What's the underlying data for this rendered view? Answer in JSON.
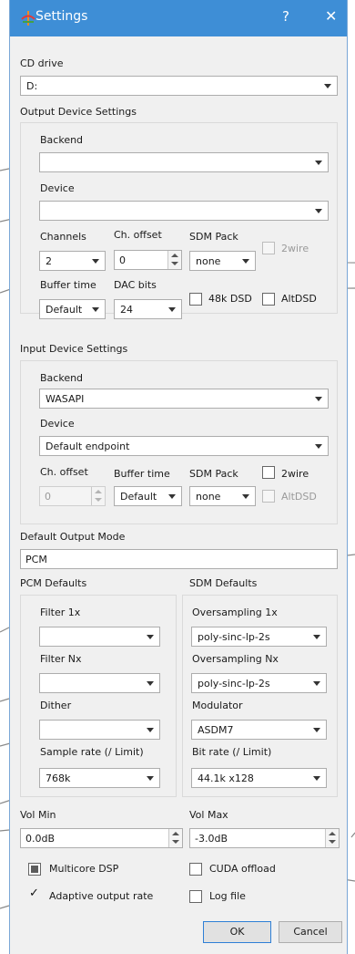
{
  "window": {
    "title": "Settings",
    "help_glyph": "?",
    "close_glyph": "✕"
  },
  "cd": {
    "label": "CD drive",
    "value": "D:"
  },
  "output": {
    "group_title": "Output Device Settings",
    "backend_label": "Backend",
    "backend_value": "",
    "device_label": "Device",
    "device_value": "",
    "channels_label": "Channels",
    "channels_value": "2",
    "choffset_label": "Ch. offset",
    "choffset_value": "0",
    "sdmpack_label": "SDM Pack",
    "sdmpack_value": "none",
    "twowire_label": "2wire",
    "buffer_label": "Buffer time",
    "buffer_value": "Default",
    "dacbits_label": "DAC bits",
    "dacbits_value": "24",
    "dsd48k_label": "48k DSD",
    "altdsd_label": "AltDSD"
  },
  "input": {
    "group_title": "Input Device Settings",
    "backend_label": "Backend",
    "backend_value": "WASAPI",
    "device_label": "Device",
    "device_value": "Default endpoint",
    "choffset_label": "Ch. offset",
    "choffset_value": "0",
    "buffer_label": "Buffer time",
    "buffer_value": "Default",
    "sdmpack_label": "SDM Pack",
    "sdmpack_value": "none",
    "twowire_label": "2wire",
    "altdsd_label": "AltDSD"
  },
  "mode": {
    "label": "Default Output Mode",
    "value": "PCM"
  },
  "pcm": {
    "title": "PCM Defaults",
    "filter1x_label": "Filter 1x",
    "filter1x_value": "",
    "filternx_label": "Filter Nx",
    "filternx_value": "",
    "dither_label": "Dither",
    "dither_value": "",
    "rate_label": "Sample rate (/ Limit)",
    "rate_value": "768k"
  },
  "sdm": {
    "title": "SDM Defaults",
    "os1x_label": "Oversampling 1x",
    "os1x_value": "poly-sinc-lp-2s",
    "osnx_label": "Oversampling Nx",
    "osnx_value": "poly-sinc-lp-2s",
    "mod_label": "Modulator",
    "mod_value": "ASDM7",
    "bitrate_label": "Bit rate (/ Limit)",
    "bitrate_value": "44.1k x128"
  },
  "vol": {
    "min_label": "Vol Min",
    "min_value": "0.0dB",
    "max_label": "Vol Max",
    "max_value": "-3.0dB"
  },
  "options": {
    "multicore_label": "Multicore DSP",
    "cuda_label": "CUDA offload",
    "adaptive_label": "Adaptive output rate",
    "logfile_label": "Log file",
    "check_glyph": "✓"
  },
  "buttons": {
    "ok": "OK",
    "cancel": "Cancel"
  },
  "colors": {
    "titlebar": "#3e8ed6",
    "default_button_border": "#2e7fd6"
  }
}
